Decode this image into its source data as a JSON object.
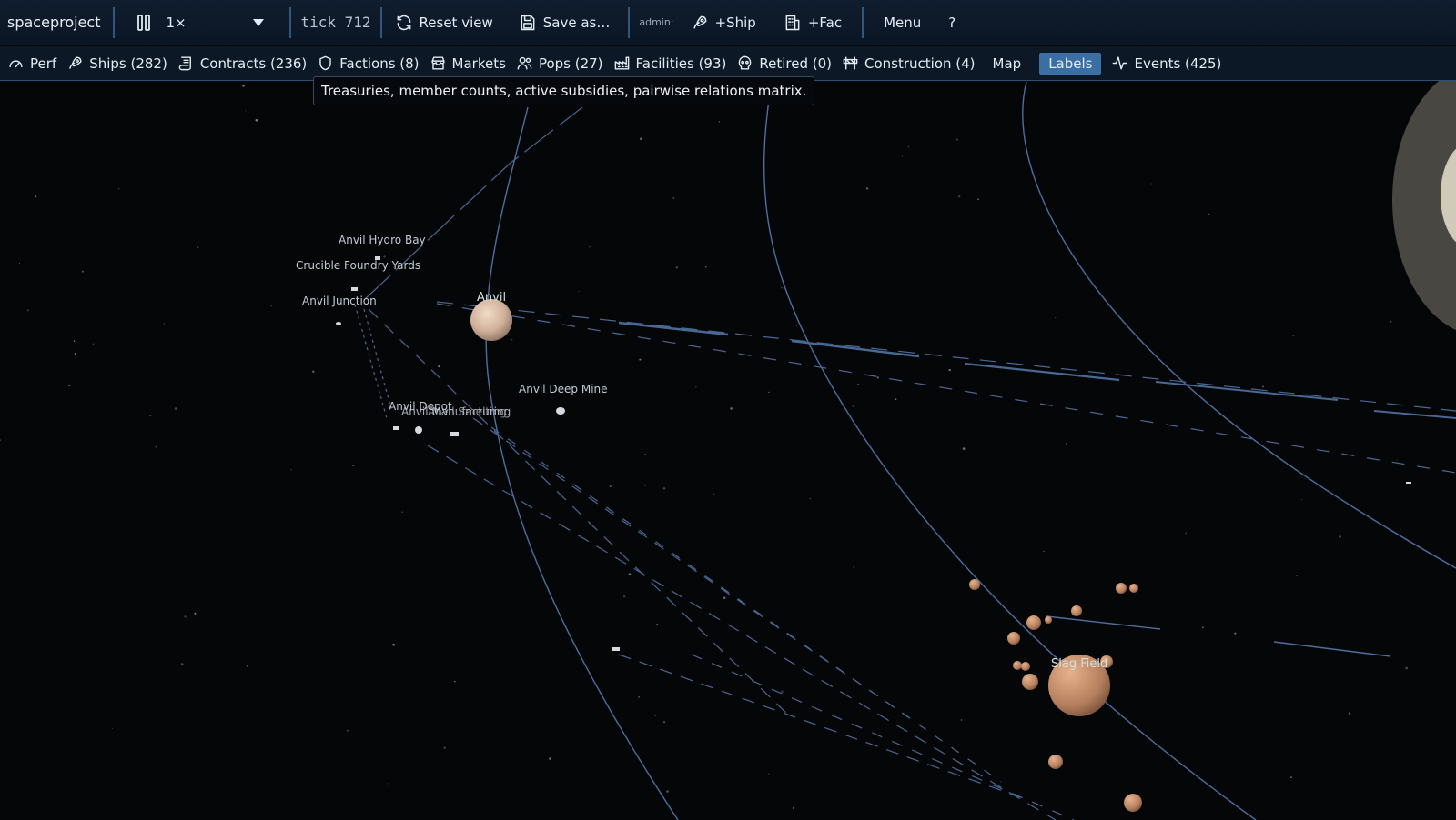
{
  "toolbar": {
    "app_name": "spaceproject",
    "pause_icon": "pause-icon",
    "speed_value": "1×",
    "tick_label": "tick 712",
    "reset_view": "Reset view",
    "save_as": "Save as…",
    "admin_label": "admin:",
    "add_ship": "+Ship",
    "add_fac": "+Fac",
    "menu": "Menu",
    "help": "?"
  },
  "tabs": [
    {
      "label": "Perf",
      "icon": "gauge-icon"
    },
    {
      "label": "Ships (282)",
      "icon": "rocket-icon"
    },
    {
      "label": "Contracts (236)",
      "icon": "scroll-icon"
    },
    {
      "label": "Factions (8)",
      "icon": "shield-icon"
    },
    {
      "label": "Markets",
      "icon": "store-icon"
    },
    {
      "label": "Pops (27)",
      "icon": "users-icon"
    },
    {
      "label": "Facilities (93)",
      "icon": "factory-icon"
    },
    {
      "label": "Retired (0)",
      "icon": "skull-icon"
    },
    {
      "label": "Construction (4)",
      "icon": "construction-icon"
    },
    {
      "label": "Map",
      "icon": ""
    },
    {
      "label": "Labels",
      "icon": "",
      "active": true
    },
    {
      "label": "Events (425)",
      "icon": "activity-icon"
    }
  ],
  "tooltip": "Treasuries, member counts, active subsidies, pairwise relations matrix.",
  "map_labels": {
    "hydro_bay": "Anvil Hydro Bay",
    "crucible": "Crucible Foundry Yards",
    "junction": "Anvil Junction",
    "anvil": "Anvil",
    "deep_mine": "Anvil Deep Mine",
    "depot": "Anvil Depot",
    "manufacturing": "Anvil Manufacturing",
    "smelting": "Anvil Smelting",
    "slag_field": "Slag Field"
  },
  "colors": {
    "background": "#050608",
    "orbit_line": "#4d6f9e",
    "bar_border": "#2a5276",
    "active_tab": "#3b6ea3",
    "asteroid": "#b88564"
  }
}
